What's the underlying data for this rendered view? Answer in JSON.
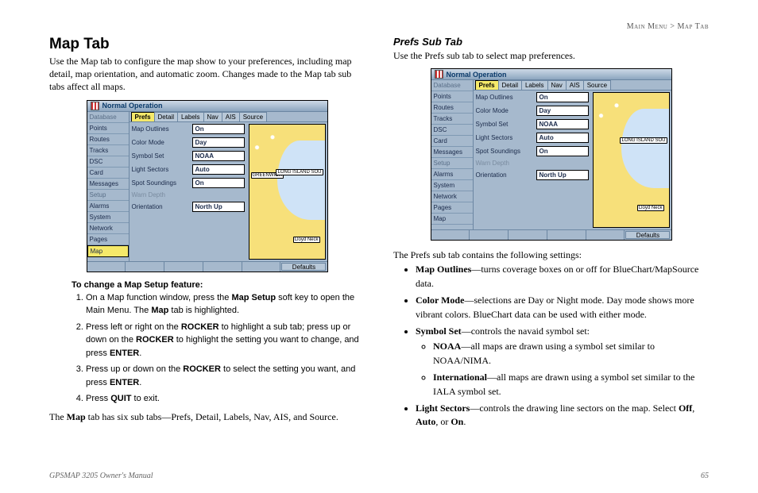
{
  "breadcrumb": {
    "left": "Main Menu",
    "sep": ">",
    "right": "Map Tab"
  },
  "left": {
    "h1": "Map Tab",
    "intro": "Use the Map tab to configure the map show to your preferences, including map detail, map orientation, and automatic zoom. Changes made to the Map tab sub tabs affect all maps.",
    "instr_head": "To change a Map Setup feature:",
    "steps": {
      "s1a": "On a Map function window, press the ",
      "s1b": "Map Setup",
      "s1c": " soft key to open the Main Menu. The ",
      "s1d": "Map",
      "s1e": " tab is highlighted.",
      "s2a": "Press left or right on the ",
      "s2b": "ROCKER",
      "s2c": " to highlight a sub tab; press up or down on the ",
      "s2d": "ROCKER",
      "s2e": " to highlight the setting you want to change, and press ",
      "s2f": "ENTER",
      "s2g": ".",
      "s3a": "Press up or down on the ",
      "s3b": "ROCKER",
      "s3c": " to select the setting you want, and press ",
      "s3d": "ENTER",
      "s3e": ".",
      "s4a": "Press ",
      "s4b": "QUIT",
      "s4c": " to exit."
    },
    "conclude_a": "The ",
    "conclude_b": "Map",
    "conclude_c": " tab has six sub tabs—Prefs, Detail, Labels, Nav, AIS, and Source."
  },
  "right": {
    "h2": "Prefs Sub Tab",
    "intro": "Use the Prefs sub tab to select map preferences.",
    "list_intro": "The Prefs sub tab contains the following settings:",
    "bullets": {
      "b1a": "Map Outlines",
      "b1b": "—turns coverage boxes on or off for BlueChart/MapSource data.",
      "b2a": "Color Mode",
      "b2b": "—selections are Day or Night mode. Day mode shows more vibrant colors. BlueChart data can be used with either mode.",
      "b3a": "Symbol Set",
      "b3b": "—controls the navaid symbol set:",
      "b3_1a": "NOAA",
      "b3_1b": "—all maps are drawn using a symbol set similar to NOAA/NIMA.",
      "b3_2a": "International",
      "b3_2b": "—all maps are drawn using a symbol set similar to the IALA symbol set.",
      "b4a": "Light Sectors",
      "b4b": "—controls the drawing line sectors on the map. Select ",
      "b4c": "Off",
      "b4d": ", ",
      "b4e": "Auto",
      "b4f": ", or ",
      "b4g": "On",
      "b4h": "."
    }
  },
  "screenshot": {
    "title": "Normal Operation",
    "side_groups": [
      "Database"
    ],
    "side_items": [
      "Points",
      "Routes",
      "Tracks",
      "DSC",
      "Card",
      "Messages"
    ],
    "side_group2": "Setup",
    "side_items2": [
      "Alarms",
      "System",
      "Network",
      "Pages",
      "Map"
    ],
    "tabs": [
      "Prefs",
      "Detail",
      "Labels",
      "Nav",
      "AIS",
      "Source"
    ],
    "rows": [
      {
        "lbl": "Map Outlines",
        "val": "On"
      },
      {
        "lbl": "Color Mode",
        "val": "Day"
      },
      {
        "lbl": "Symbol Set",
        "val": "NOAA"
      },
      {
        "lbl": "Light Sectors",
        "val": "Auto"
      },
      {
        "lbl": "Spot Soundings",
        "val": "On"
      },
      {
        "lbl": "Warn Depth",
        "val": ""
      },
      {
        "lbl": "Orientation",
        "val": "North Up"
      }
    ],
    "map_labels": [
      "GREENWICH",
      "LONG ISLAND SOU",
      "Lloyd Neck"
    ],
    "defaults": "Defaults"
  },
  "footer": {
    "left": "GPSMAP 3205 Owner's Manual",
    "right": "65"
  }
}
